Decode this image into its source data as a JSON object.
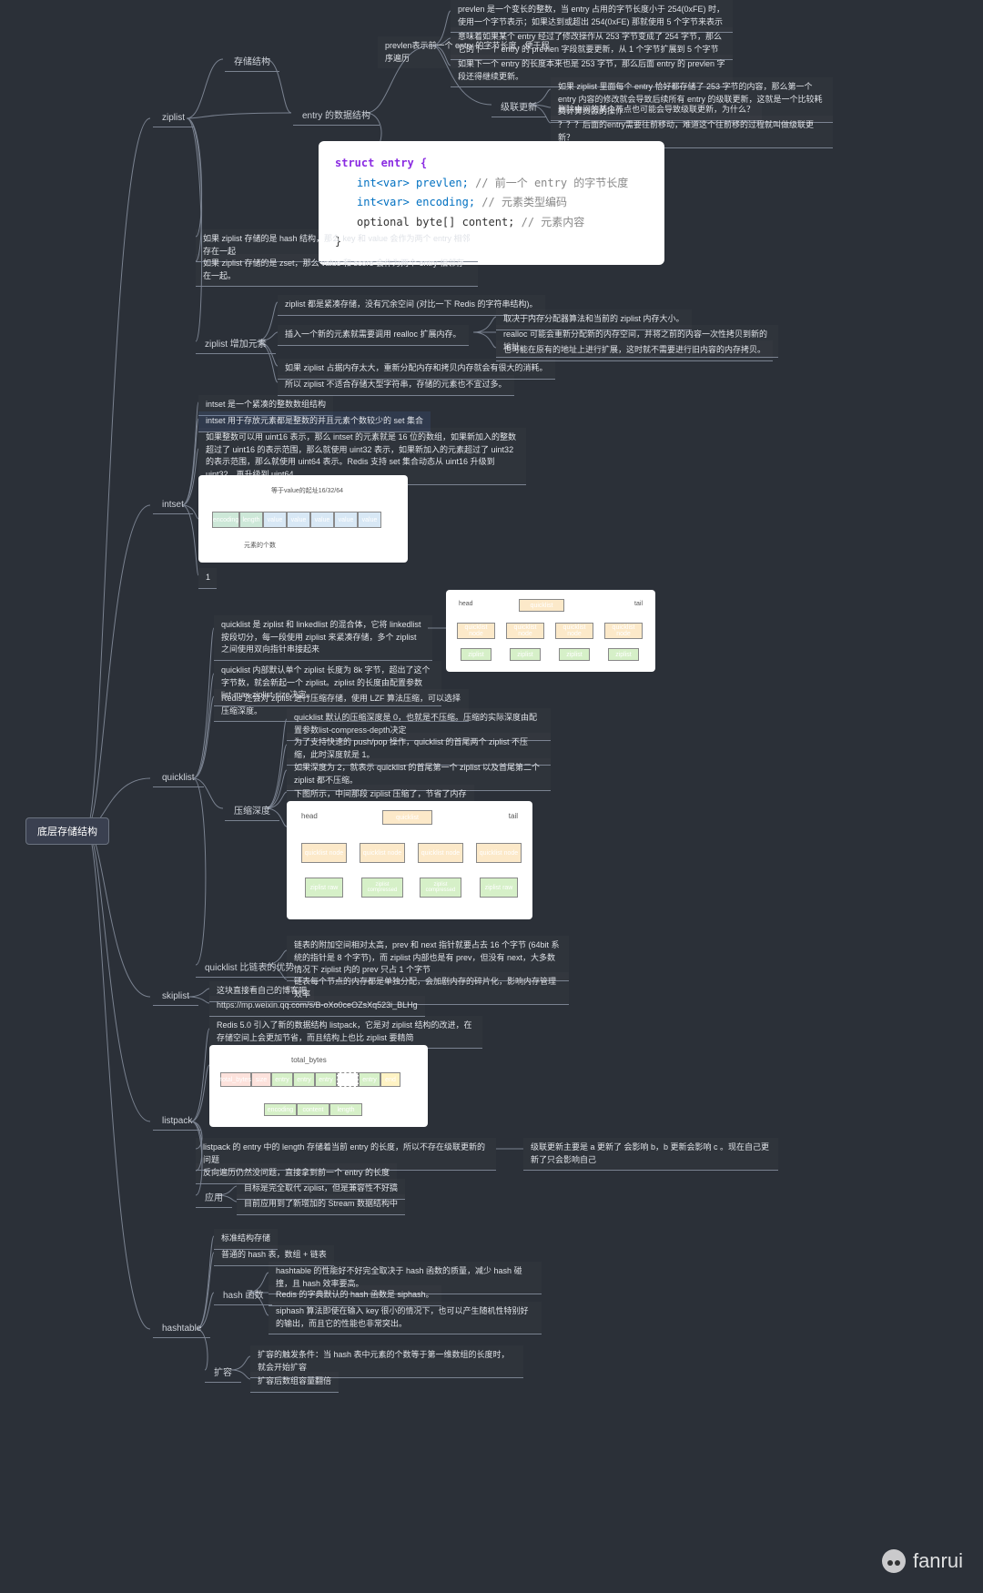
{
  "root": "底层存储结构",
  "watermark": "fanrui",
  "ziplist": {
    "label": "ziplist",
    "storage": {
      "label": "存储结构",
      "entry": {
        "label": "entry 的数据结构",
        "prevlen": "prevlen表示前一个 entry 的字节长度，便于程序遍历",
        "p1": "prevlen 是一个变长的整数，当 entry 占用的字节长度小于 254(0xFE) 时，使用一个字节表示；如果达到或超出 254(0xFE) 那就使用 5 个字节来表示",
        "p2": "意味着如果某个 entry 经过了修改操作从 253 字节变成了 254 字节，那么它的下一个 entry 的 prevlen 字段就要更新，从 1 个字节扩展到 5 个字节",
        "p3": "如果下一个 entry 的长度本来也是 253 字节，那么后面 entry 的 prevlen 字段还得继续更新。",
        "cascade": {
          "label": "级联更新",
          "c1": "如果 ziplist 里面每个 entry 恰好都存储了 253 字节的内容，那么第一个 entry 内容的修改就会导致后续所有 entry 的级联更新，这就是一个比较耗费计算资源的操作",
          "c2": "删除中间的某个节点也可能会导致级联更新，为什么？",
          "c3": "？？？后面的entry需要往前移动，难道这个往前移的过程就叫做级联更新？"
        }
      }
    },
    "code": {
      "l1": "struct entry {",
      "l2": "int<var> prevlen;",
      "l2c": "// 前一个 entry 的字节长度",
      "l3": "int<var> encoding;",
      "l3c": "// 元素类型编码",
      "l4": "optional byte[] content;",
      "l4c": "// 元素内容",
      "l5": "}"
    },
    "h1": "如果 ziplist 存储的是 hash 结构，那么 key 和 value 会作为两个 entry 相邻存在一起",
    "h2": "如果 ziplist 存储的是 zset，那么 value 和 score 会作为两个 entry 相邻存在一起。",
    "add": {
      "label": "ziplist 增加元素",
      "a1": "ziplist 都是紧凑存储，没有冗余空间 (对比一下 Redis 的字符串结构)。",
      "a2": "插入一个新的元素就需要调用 realloc 扩展内存。",
      "a21": "取决于内存分配器算法和当前的 ziplist 内存大小。",
      "a22": "realloc 可能会重新分配新的内存空间，并将之前的内容一次性拷贝到新的地址。",
      "a23": "也可能在原有的地址上进行扩展，这时就不需要进行旧内容的内存拷贝。",
      "a3": "如果 ziplist 占据内存太大，重新分配内存和拷贝内存就会有很大的消耗。",
      "a4": "所以 ziplist 不适合存储大型字符串，存储的元素也不宜过多。"
    }
  },
  "intset": {
    "label": "intset",
    "i1": "intset 是一个紧凑的整数数组结构",
    "i2": "intset 用于存放元素都是整数的并且元素个数较少的 set 集合",
    "i3": "如果整数可以用 uint16 表示，那么 intset 的元素就是 16 位的数组，如果新加入的整数超过了 uint16 的表示范围，那么就使用 uint32 表示，如果新加入的元素超过了 uint32 的表示范围，那么就使用 uint64 表示。Redis 支持 set 集合动态从 uint16 升级到 uint32，再升级到 uint64。",
    "img_title": "等于value的起址16/32/64",
    "img_labels": [
      "encoding",
      "length",
      "value",
      "value",
      "value",
      "value",
      "value"
    ],
    "img_foot": "元素的个数",
    "i4": "1"
  },
  "quicklist": {
    "label": "quicklist",
    "q1": "quicklist 是 ziplist 和 linkedlist 的混合体，它将 linkedlist 按段切分，每一段使用 ziplist 来紧凑存储，多个 ziplist 之间使用双向指针串接起来",
    "q2": "quicklist 内部默认单个 ziplist 长度为 8k 字节，超出了这个字节数，就会新起一个 ziplist。ziplist 的长度由配置参数list-max-ziplist-size决定。",
    "q3": "Redis 还会对 ziplist 进行压缩存储，使用 LZF 算法压缩，可以选择压缩深度。",
    "depth": {
      "label": "压缩深度",
      "d1": "quicklist 默认的压缩深度是 0，也就是不压缩。压缩的实际深度由配置参数list-compress-depth决定",
      "d2": "为了支持快速的 push/pop 操作，quicklist 的首尾两个 ziplist 不压缩，此时深度就是 1。",
      "d3": "如果深度为 2，就表示 quicklist 的首尾第一个 ziplist 以及首尾第二个 ziplist 都不压缩。",
      "d4": "下图所示，中间那段 ziplist 压缩了，节省了内存"
    },
    "adv": {
      "label": "quicklist 比链表的优势",
      "a1": "链表的附加空间相对太高，prev 和 next 指针就要占去 16 个字节 (64bit 系统的指针是 8 个字节)，而 ziplist 内部也是有 prev，但没有 next，大多数情况下 ziplist 内的 prev 只占 1 个字节",
      "a2": "链表每个节点的内存都是单独分配，会加剧内存的碎片化，影响内存管理效率"
    },
    "img1": {
      "head": "head",
      "tail": "tail",
      "ql": "quicklist",
      "node": "quicklist node",
      "zip": "ziplist"
    },
    "img2": {
      "head": "head",
      "tail": "tail",
      "ql": "quicklist",
      "node": "quicklist node",
      "raw": "ziplist raw",
      "comp": "ziplist compressed"
    }
  },
  "skiplist": {
    "label": "skiplist",
    "s1": "这块直接看自己的博客吧",
    "s2": "https://mp.weixin.qq.com/s/B-oXo0ceOZsXq523i_BLHg"
  },
  "listpack": {
    "label": "listpack",
    "l1": "Redis 5.0 引入了新的数据结构 listpack，它是对 ziplist 结构的改进，在存储空间上会更加节省，而且结构上也比 ziplist 要精简",
    "l2": "listpack 的 entry 中的 length 存储着当前 entry 的长度，所以不存在级联更新的问题",
    "l2r": "级联更新主要是 a 更新了 会影响 b，b 更新会影响 c 。现在自己更新了只会影响自己",
    "l3": "反向遍历仍然没问题，直接拿到前一个 entry 的长度",
    "app": {
      "label": "应用",
      "a1": "目标是完全取代 ziplist，但是兼容性不好搞",
      "a2": "目前应用到了新增加的 Stream 数据结构中"
    },
    "img": {
      "t": "total_bytes",
      "c": [
        "total_bytes",
        "size",
        "entry",
        "entry",
        "entry",
        "...",
        "entry",
        "end"
      ],
      "b": [
        "encoding",
        "content",
        "length"
      ]
    }
  },
  "hashtable": {
    "label": "hashtable",
    "h1": "标准结构存储",
    "h2": "普通的 hash 表，数组 + 链表",
    "hash": {
      "label": "hash 函数",
      "f1": "hashtable 的性能好不好完全取决于 hash 函数的质量，减少 hash 碰撞，且 hash 效率要高。",
      "f2": "Redis 的字典默认的 hash 函数是 siphash。",
      "f3": "siphash 算法即使在输入 key 很小的情况下，也可以产生随机性特别好的输出，而且它的性能也非常突出。"
    },
    "expand": {
      "label": "扩容",
      "e1": "扩容的触发条件：当 hash 表中元素的个数等于第一维数组的长度时，就会开始扩容",
      "e2": "扩容后数组容量翻倍"
    }
  }
}
